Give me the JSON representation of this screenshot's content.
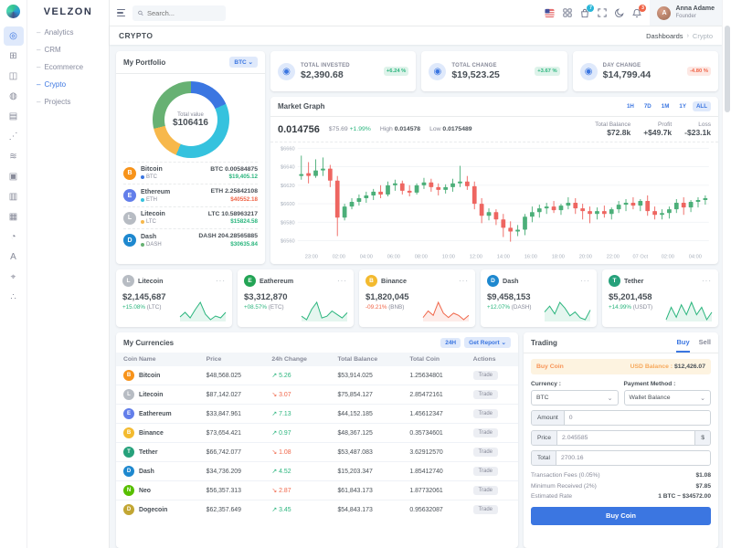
{
  "colors": {
    "primary": "#3b76e1",
    "success": "#2ab57d",
    "danger": "#f06548",
    "warning": "#f7b84b",
    "muted": "#878a99",
    "candle_up": "#4caf79",
    "candle_down": "#ee6661"
  },
  "brand": {
    "logo_text": "VELZON"
  },
  "topbar": {
    "search_placeholder": "Search...",
    "cart_badge": "7",
    "bell_badge": "3",
    "user": {
      "name": "Anna Adame",
      "role": "Founder",
      "initial": "A"
    }
  },
  "page": {
    "title": "CRYPTO",
    "breadcrumb_root": "Dashboards",
    "breadcrumb_sep": "›",
    "breadcrumb_current": "Crypto"
  },
  "sidebar": {
    "bullet": "–",
    "rail": [
      {
        "name": "dashboards-icon",
        "glyph": "◎",
        "active": true
      },
      {
        "name": "apps-icon",
        "glyph": "⊞",
        "active": false
      },
      {
        "name": "layouts-icon",
        "glyph": "◫",
        "active": false
      },
      {
        "name": "authentication-icon",
        "glyph": "◍",
        "active": false
      },
      {
        "name": "pages-icon",
        "glyph": "▤",
        "active": false
      },
      {
        "name": "widgets-icon",
        "glyph": "⋰",
        "active": false
      },
      {
        "name": "ui-elements-icon",
        "glyph": "≋",
        "active": false
      },
      {
        "name": "forms-icon",
        "glyph": "▣",
        "active": false
      },
      {
        "name": "tables-icon",
        "glyph": "▥",
        "active": false
      },
      {
        "name": "grids-icon",
        "glyph": "▦",
        "active": false
      },
      {
        "name": "charts-icon",
        "glyph": "◔",
        "active": false
      },
      {
        "name": "icons-icon",
        "glyph": "A",
        "active": false
      },
      {
        "name": "maps-icon",
        "glyph": "⌖",
        "active": false
      },
      {
        "name": "multilevel-icon",
        "glyph": "∴",
        "active": false
      }
    ],
    "items": [
      {
        "label": "Analytics",
        "active": false
      },
      {
        "label": "CRM",
        "active": false
      },
      {
        "label": "Ecommerce",
        "active": false
      },
      {
        "label": "Crypto",
        "active": true
      },
      {
        "label": "Projects",
        "active": false
      }
    ]
  },
  "portfolio": {
    "title": "My Portfolio",
    "currency_select": "BTC",
    "center_label": "Total value",
    "center_value": "$106416",
    "assets": [
      {
        "name": "Bitcoin",
        "ticker": "BTC",
        "letter": "B",
        "icon_bg": "#f7931a",
        "chart_color": "#3b76e1",
        "pct": 18.24,
        "amount": "BTC 0.00584875",
        "value": "$19,405.12",
        "dir": "up"
      },
      {
        "name": "Ethereum",
        "ticker": "ETH",
        "letter": "E",
        "icon_bg": "#627eea",
        "chart_color": "#35c2de",
        "pct": 38.11,
        "amount": "ETH 2.25842108",
        "value": "$40552.18",
        "dir": "down"
      },
      {
        "name": "Litecoin",
        "ticker": "LTC",
        "letter": "L",
        "icon_bg": "#b7bcc3",
        "chart_color": "#f7b84b",
        "pct": 14.87,
        "amount": "LTC 10.58963217",
        "value": "$15824.58",
        "dir": "up"
      },
      {
        "name": "Dash",
        "ticker": "DASH",
        "letter": "D",
        "icon_bg": "#1e88cf",
        "chart_color": "#67b173",
        "pct": 28.78,
        "amount": "DASH 204.28565885",
        "value": "$30635.84",
        "dir": "up"
      }
    ]
  },
  "stats": [
    {
      "label": "TOTAL INVESTED",
      "value": "$2,390.68",
      "badge": "+6.24 %",
      "dir": "up"
    },
    {
      "label": "TOTAL CHANGE",
      "value": "$19,523.25",
      "badge": "+3.67 %",
      "dir": "up"
    },
    {
      "label": "DAY CHANGE",
      "value": "$14,799.44",
      "badge": "-4.80 %",
      "dir": "down"
    }
  ],
  "market": {
    "title": "Market Graph",
    "ranges": [
      "1H",
      "7D",
      "1M",
      "1Y",
      "ALL"
    ],
    "active_range": "ALL",
    "price": "0.014756",
    "delta": "$75.69",
    "delta_pct": "+1.99%",
    "high_label": "High",
    "high": "0.014578",
    "low_label": "Low",
    "low": "0.0175489",
    "balance_label": "Total Balance",
    "balance": "$72.8k",
    "profit_label": "Profit",
    "profit": "+$49.7k",
    "loss_label": "Loss",
    "loss": "-$23.1k",
    "chart_data": {
      "type": "candlestick",
      "y_prefix": "$",
      "y_ticks": [
        6560,
        6580,
        6600,
        6620,
        6640,
        6660
      ],
      "x_labels": [
        "23:00",
        "02:00",
        "04:00",
        "06:00",
        "08:00",
        "10:00",
        "12:00",
        "14:00",
        "16:00",
        "18:00",
        "20:00",
        "22:00",
        "07 Oct",
        "02:00",
        "04:00"
      ],
      "candles": [
        [
          6630,
          6652,
          6626,
          6632
        ],
        [
          6633,
          6645,
          6622,
          6630
        ],
        [
          6630,
          6648,
          6628,
          6636
        ],
        [
          6636,
          6650,
          6630,
          6638
        ],
        [
          6638,
          6642,
          6618,
          6625
        ],
        [
          6625,
          6630,
          6565,
          6585
        ],
        [
          6585,
          6600,
          6582,
          6597
        ],
        [
          6597,
          6606,
          6594,
          6602
        ],
        [
          6602,
          6610,
          6598,
          6606
        ],
        [
          6606,
          6613,
          6601,
          6609
        ],
        [
          6609,
          6616,
          6604,
          6613
        ],
        [
          6613,
          6620,
          6606,
          6610
        ],
        [
          6610,
          6624,
          6608,
          6620
        ],
        [
          6620,
          6626,
          6614,
          6622
        ],
        [
          6622,
          6625,
          6610,
          6614
        ],
        [
          6614,
          6620,
          6608,
          6612
        ],
        [
          6612,
          6622,
          6610,
          6620
        ],
        [
          6620,
          6628,
          6616,
          6623
        ],
        [
          6623,
          6627,
          6613,
          6618
        ],
        [
          6618,
          6622,
          6609,
          6615
        ],
        [
          6615,
          6621,
          6611,
          6618
        ],
        [
          6618,
          6627,
          6613,
          6622
        ],
        [
          6622,
          6641,
          6618,
          6624
        ],
        [
          6624,
          6630,
          6615,
          6619
        ],
        [
          6619,
          6624,
          6594,
          6600
        ],
        [
          6600,
          6606,
          6579,
          6587
        ],
        [
          6587,
          6595,
          6582,
          6591
        ],
        [
          6591,
          6594,
          6577,
          6583
        ],
        [
          6583,
          6589,
          6564,
          6574
        ],
        [
          6574,
          6581,
          6559,
          6570
        ],
        [
          6570,
          6577,
          6565,
          6572
        ],
        [
          6572,
          6589,
          6566,
          6586
        ],
        [
          6586,
          6597,
          6580,
          6591
        ],
        [
          6591,
          6599,
          6585,
          6595
        ],
        [
          6595,
          6601,
          6589,
          6597
        ],
        [
          6597,
          6603,
          6590,
          6593
        ],
        [
          6593,
          6600,
          6588,
          6598
        ],
        [
          6598,
          6607,
          6594,
          6601
        ],
        [
          6601,
          6606,
          6589,
          6595
        ],
        [
          6595,
          6600,
          6583,
          6592
        ],
        [
          6592,
          6597,
          6579,
          6589
        ],
        [
          6589,
          6596,
          6583,
          6592
        ],
        [
          6592,
          6598,
          6585,
          6589
        ],
        [
          6589,
          6596,
          6583,
          6594
        ],
        [
          6594,
          6603,
          6590,
          6599
        ],
        [
          6599,
          6605,
          6592,
          6601
        ],
        [
          6601,
          6607,
          6594,
          6598
        ],
        [
          6598,
          6605,
          6592,
          6603
        ],
        [
          6603,
          6609,
          6587,
          6592
        ],
        [
          6592,
          6597,
          6583,
          6588
        ],
        [
          6588,
          6594,
          6583,
          6590
        ],
        [
          6590,
          6597,
          6584,
          6594
        ],
        [
          6594,
          6605,
          6590,
          6601
        ],
        [
          6601,
          6607,
          6588,
          6596
        ],
        [
          6596,
          6604,
          6591,
          6602
        ],
        [
          6602,
          6607,
          6596,
          6604
        ],
        [
          6604,
          6609,
          6599,
          6606
        ]
      ]
    }
  },
  "coin_cards": [
    {
      "name": "Litecoin",
      "letter": "L",
      "icon_bg": "#b7bcc3",
      "value": "$2,145,687",
      "change": "+15.08%",
      "pair": "(LTC)",
      "dir": "up",
      "spark": [
        8,
        13,
        7,
        16,
        24,
        11,
        5,
        9,
        7,
        13
      ]
    },
    {
      "name": "Eathereum",
      "letter": "E",
      "icon_bg": "#23a455",
      "value": "$3,312,870",
      "change": "+08.57%",
      "pair": "(ETC)",
      "dir": "up",
      "spark": [
        10,
        6,
        18,
        26,
        8,
        10,
        16,
        12,
        8,
        14
      ]
    },
    {
      "name": "Binance",
      "letter": "B",
      "icon_bg": "#f3ba2f",
      "value": "$1,820,045",
      "change": "-09.21%",
      "pair": "(BNB)",
      "dir": "down",
      "spark": [
        7,
        13,
        9,
        21,
        11,
        7,
        11,
        9,
        5,
        9
      ]
    },
    {
      "name": "Dash",
      "letter": "D",
      "icon_bg": "#1e88cf",
      "value": "$9,458,153",
      "change": "+12.07%",
      "pair": "(DASH)",
      "dir": "up",
      "spark": [
        12,
        18,
        10,
        22,
        16,
        8,
        12,
        6,
        4,
        14
      ]
    },
    {
      "name": "Tether",
      "letter": "T",
      "icon_bg": "#26a17b",
      "value": "$5,201,458",
      "change": "+14.99%",
      "pair": "(USDT)",
      "dir": "up",
      "spark": [
        6,
        16,
        8,
        18,
        10,
        20,
        10,
        16,
        6,
        12
      ]
    }
  ],
  "currencies": {
    "title": "My Currencies",
    "range_button": "24H",
    "report_button": "Get Report",
    "report_chevron": "⌄",
    "columns": [
      "Coin Name",
      "Price",
      "24h Change",
      "Total Balance",
      "Total Coin",
      "Actions"
    ],
    "trade_label": "Trade",
    "rows": [
      {
        "name": "Bitcoin",
        "letter": "B",
        "icon_bg": "#f7931a",
        "price": "$48,568.025",
        "change": "↗ 5.26",
        "dir": "up",
        "balance": "$53,914.025",
        "coin": "1.25634801"
      },
      {
        "name": "Litecoin",
        "letter": "L",
        "icon_bg": "#b7bcc3",
        "price": "$87,142.027",
        "change": "↘ 3.07",
        "dir": "down",
        "balance": "$75,854.127",
        "coin": "2.85472161"
      },
      {
        "name": "Eathereum",
        "letter": "E",
        "icon_bg": "#627eea",
        "price": "$33,847.961",
        "change": "↗ 7.13",
        "dir": "up",
        "balance": "$44,152.185",
        "coin": "1.45612347"
      },
      {
        "name": "Binance",
        "letter": "B",
        "icon_bg": "#f3ba2f",
        "price": "$73,654.421",
        "change": "↗ 0.97",
        "dir": "up",
        "balance": "$48,367.125",
        "coin": "0.35734601"
      },
      {
        "name": "Tether",
        "letter": "T",
        "icon_bg": "#26a17b",
        "price": "$66,742.077",
        "change": "↘ 1.08",
        "dir": "down",
        "balance": "$53,487.083",
        "coin": "3.62912570"
      },
      {
        "name": "Dash",
        "letter": "D",
        "icon_bg": "#1e88cf",
        "price": "$34,736.209",
        "change": "↗ 4.52",
        "dir": "up",
        "balance": "$15,203.347",
        "coin": "1.85412740"
      },
      {
        "name": "Neo",
        "letter": "N",
        "icon_bg": "#58bf00",
        "price": "$56,357.313",
        "change": "↘ 2.87",
        "dir": "down",
        "balance": "$61,843.173",
        "coin": "1.87732061"
      },
      {
        "name": "Dogecoin",
        "letter": "D",
        "icon_bg": "#c2a633",
        "price": "$62,357.649",
        "change": "↗ 3.45",
        "dir": "up",
        "balance": "$54,843.173",
        "coin": "0.95632087"
      }
    ]
  },
  "trading": {
    "title": "Trading",
    "tabs": [
      "Buy",
      "Sell"
    ],
    "active_tab": "Buy",
    "banner_label": "Buy Coin",
    "balance_label": "USD Balance :",
    "balance_value": "$12,426.07",
    "currency_label": "Currency :",
    "currency_value": "BTC",
    "payment_label": "Payment Method :",
    "payment_value": "Wallet Balance",
    "amount_label": "Amount",
    "amount_value": "0",
    "price_label": "Price",
    "price_value": "2.045585",
    "price_suffix": "$",
    "total_label": "Total",
    "total_value": "2700.16",
    "details": [
      {
        "label": "Transaction Fees (0.05%)",
        "value": "$1.08"
      },
      {
        "label": "Minimum Received (2%)",
        "value": "$7.85"
      },
      {
        "label": "Estimated Rate",
        "value": "1 BTC ~ $34572.00"
      }
    ],
    "submit": "Buy Coin"
  }
}
